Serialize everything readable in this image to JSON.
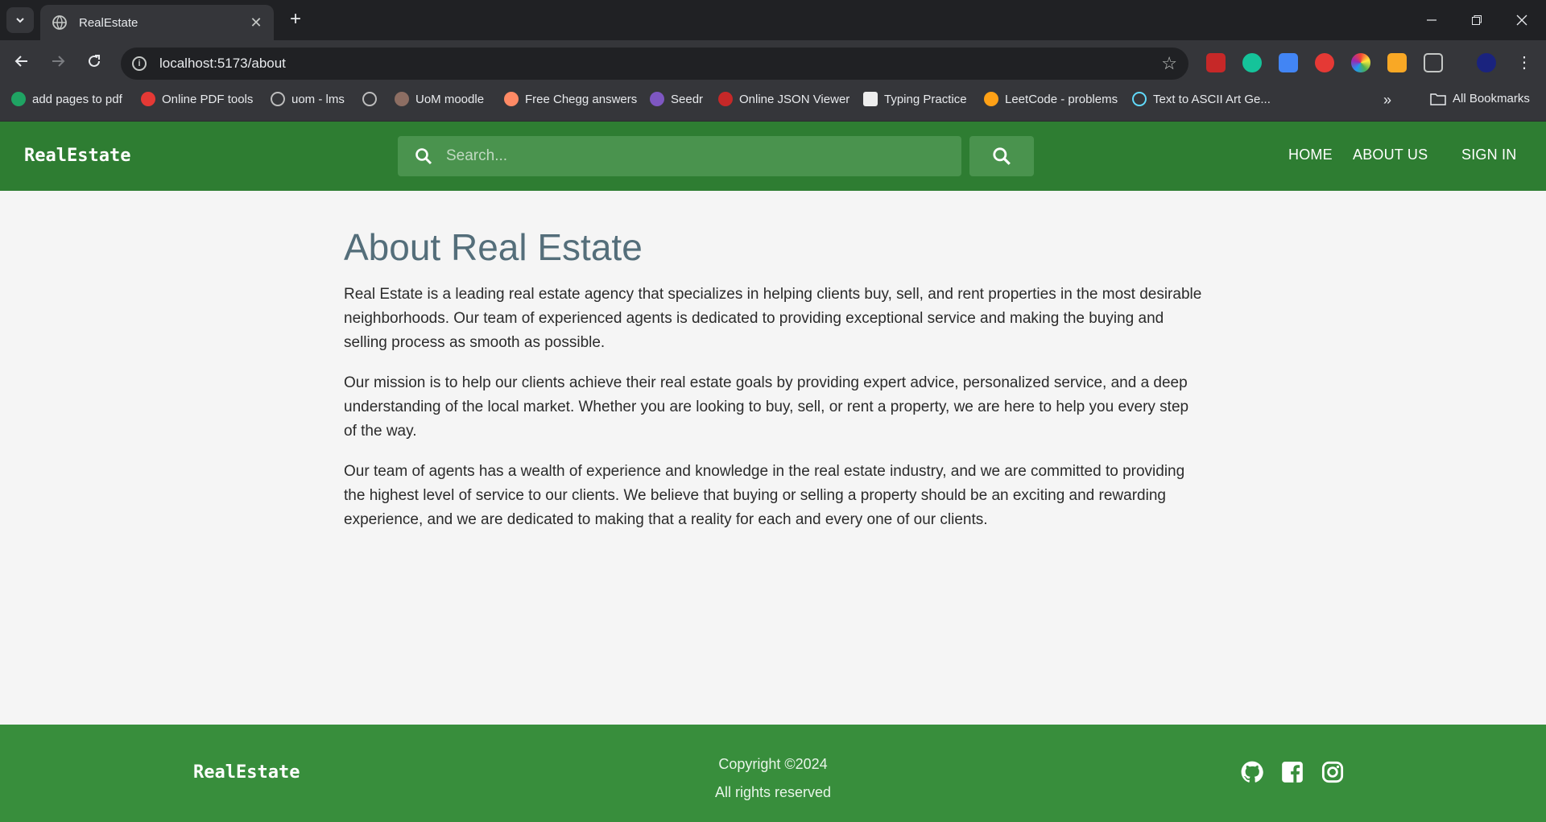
{
  "browser": {
    "tab_title": "RealEstate",
    "url": "localhost:5173/about",
    "bookmarks": [
      {
        "label": "add pages to pdf",
        "icon": "s-circle-icon",
        "color": "#1fa463"
      },
      {
        "label": "Online PDF tools",
        "icon": "heart-icon",
        "color": "#e53935"
      },
      {
        "label": "uom - lms",
        "icon": "globe-icon",
        "color": "#bdbdbd"
      },
      {
        "label": "",
        "icon": "globe-icon",
        "color": "#bdbdbd"
      },
      {
        "label": "UoM moodle",
        "icon": "moodle-icon",
        "color": "#8d6e63"
      },
      {
        "label": "Free Chegg answers",
        "icon": "books-icon",
        "color": "#ff8a65"
      },
      {
        "label": "Seedr",
        "icon": "seed-icon",
        "color": "#7e57c2"
      },
      {
        "label": "Online JSON Viewer",
        "icon": "json-icon",
        "color": "#c62828"
      },
      {
        "label": "Typing Practice",
        "icon": "keyboard-icon",
        "color": "#eeeeee"
      },
      {
        "label": "LeetCode - problems",
        "icon": "leetcode-icon",
        "color": "#ffa116"
      },
      {
        "label": "Text to ASCII Art Ge...",
        "icon": "react-icon",
        "color": "#61dafb"
      }
    ],
    "all_bookmarks_label": "All Bookmarks"
  },
  "header": {
    "brand": "RealEstate",
    "search_placeholder": "Search...",
    "nav": {
      "home": "HOME",
      "about": "ABOUT US",
      "signin": "SIGN IN"
    }
  },
  "main": {
    "title": "About Real Estate",
    "paragraphs": [
      "Real Estate is a leading real estate agency that specializes in helping clients buy, sell, and rent properties in the most desirable neighborhoods. Our team of experienced agents is dedicated to providing exceptional service and making the buying and selling process as smooth as possible.",
      "Our mission is to help our clients achieve their real estate goals by providing expert advice, personalized service, and a deep understanding of the local market. Whether you are looking to buy, sell, or rent a property, we are here to help you every step of the way.",
      "Our team of agents has a wealth of experience and knowledge in the real estate industry, and we are committed to providing the highest level of service to our clients. We believe that buying or selling a property should be an exciting and rewarding experience, and we are dedicated to making that a reality for each and every one of our clients."
    ]
  },
  "footer": {
    "brand": "RealEstate",
    "copyright": "Copyright ©2024",
    "rights": "All rights reserved",
    "social": [
      "github-icon",
      "facebook-icon",
      "instagram-icon"
    ]
  },
  "colors": {
    "header_green": "#2e7d32",
    "footer_green": "#388e3c",
    "title_color": "#546e7a"
  }
}
